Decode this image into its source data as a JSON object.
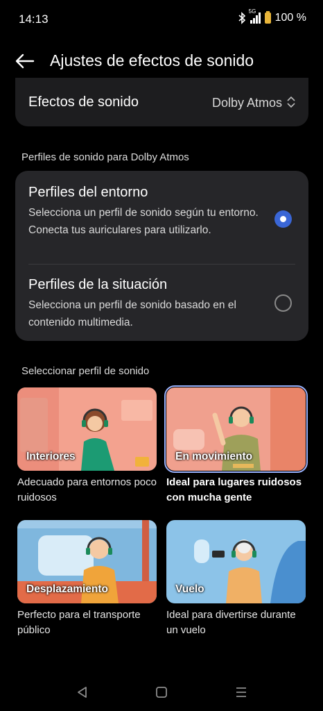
{
  "status": {
    "time": "14:13",
    "network": "5G",
    "battery": "100 %"
  },
  "header": {
    "title": "Ajustes de efectos de sonido",
    "back_icon": "back-arrow-icon"
  },
  "effects": {
    "label": "Efectos de sonido",
    "value": "Dolby Atmos"
  },
  "dolby_section": {
    "label": "Perfiles de sonido para Dolby Atmos",
    "options": [
      {
        "title": "Perfiles del entorno",
        "description": "Selecciona un perfil de sonido según tu entorno. Conecta tus auriculares para utilizarlo.",
        "selected": true
      },
      {
        "title": "Perfiles de la situación",
        "description": "Selecciona un perfil de sonido basado en el contenido multimedia.",
        "selected": false
      }
    ]
  },
  "profile_section": {
    "label": "Seleccionar perfil de sonido",
    "tiles": [
      {
        "name": "Interiores",
        "description": "Adecuado para entornos poco ruidosos",
        "selected": false
      },
      {
        "name": "En movimiento",
        "description": "Ideal para lugares ruidosos con mucha gente",
        "selected": true
      },
      {
        "name": "Desplazamiento",
        "description": "Perfecto para el transporte público",
        "selected": false
      },
      {
        "name": "Vuelo",
        "description": "Ideal para divertirse durante un vuelo",
        "selected": false
      }
    ]
  },
  "colors": {
    "accent": "#3a66d6",
    "card": "#262629",
    "battery": "#e8b53a"
  },
  "nav": {
    "back": "nav-back-icon",
    "home": "nav-home-icon",
    "recents": "nav-recents-icon"
  }
}
